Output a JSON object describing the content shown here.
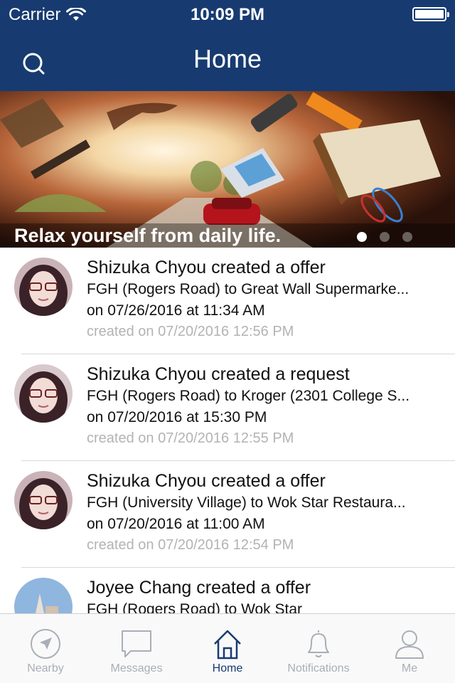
{
  "status_bar": {
    "carrier": "Carrier",
    "time": "10:09 PM"
  },
  "nav": {
    "title": "Home",
    "search_icon": "search-icon"
  },
  "banner": {
    "caption": "Relax yourself from daily life.",
    "dot_count": 3,
    "active_dot": 0
  },
  "feed": [
    {
      "title": "Shizuka Chyou created a offer",
      "route": "FGH (Rogers Road) to Great Wall Supermarke...",
      "time": "on 07/26/2016 at 11:34 AM",
      "created": "created on 07/20/2016 12:56 PM",
      "avatar": "avatar-woman"
    },
    {
      "title": "Shizuka Chyou created a request",
      "route": "FGH (Rogers Road) to Kroger (2301 College S...",
      "time": "on 07/20/2016 at 15:30 PM",
      "created": "created on 07/20/2016 12:55 PM",
      "avatar": "avatar-woman"
    },
    {
      "title": "Shizuka Chyou created a offer",
      "route": "FGH (University Village) to Wok Star Restaura...",
      "time": "on 07/20/2016 at 11:00 AM",
      "created": "created on 07/20/2016 12:54 PM",
      "avatar": "avatar-woman"
    },
    {
      "title": "Joyee Chang created a offer",
      "route": "FGH (Rogers Road) to Wok Star",
      "time": "",
      "created": "",
      "avatar": "avatar-landscape"
    }
  ],
  "tabs": [
    {
      "label": "Nearby",
      "icon": "navigation-icon",
      "active": false
    },
    {
      "label": "Messages",
      "icon": "message-icon",
      "active": false
    },
    {
      "label": "Home",
      "icon": "home-icon",
      "active": true
    },
    {
      "label": "Notifications",
      "icon": "bell-icon",
      "active": false
    },
    {
      "label": "Me",
      "icon": "person-icon",
      "active": false
    }
  ],
  "colors": {
    "header": "#173b70",
    "tab_active": "#173b70",
    "tab_inactive": "#a9aeb7",
    "muted_text": "#b3b3b3"
  }
}
